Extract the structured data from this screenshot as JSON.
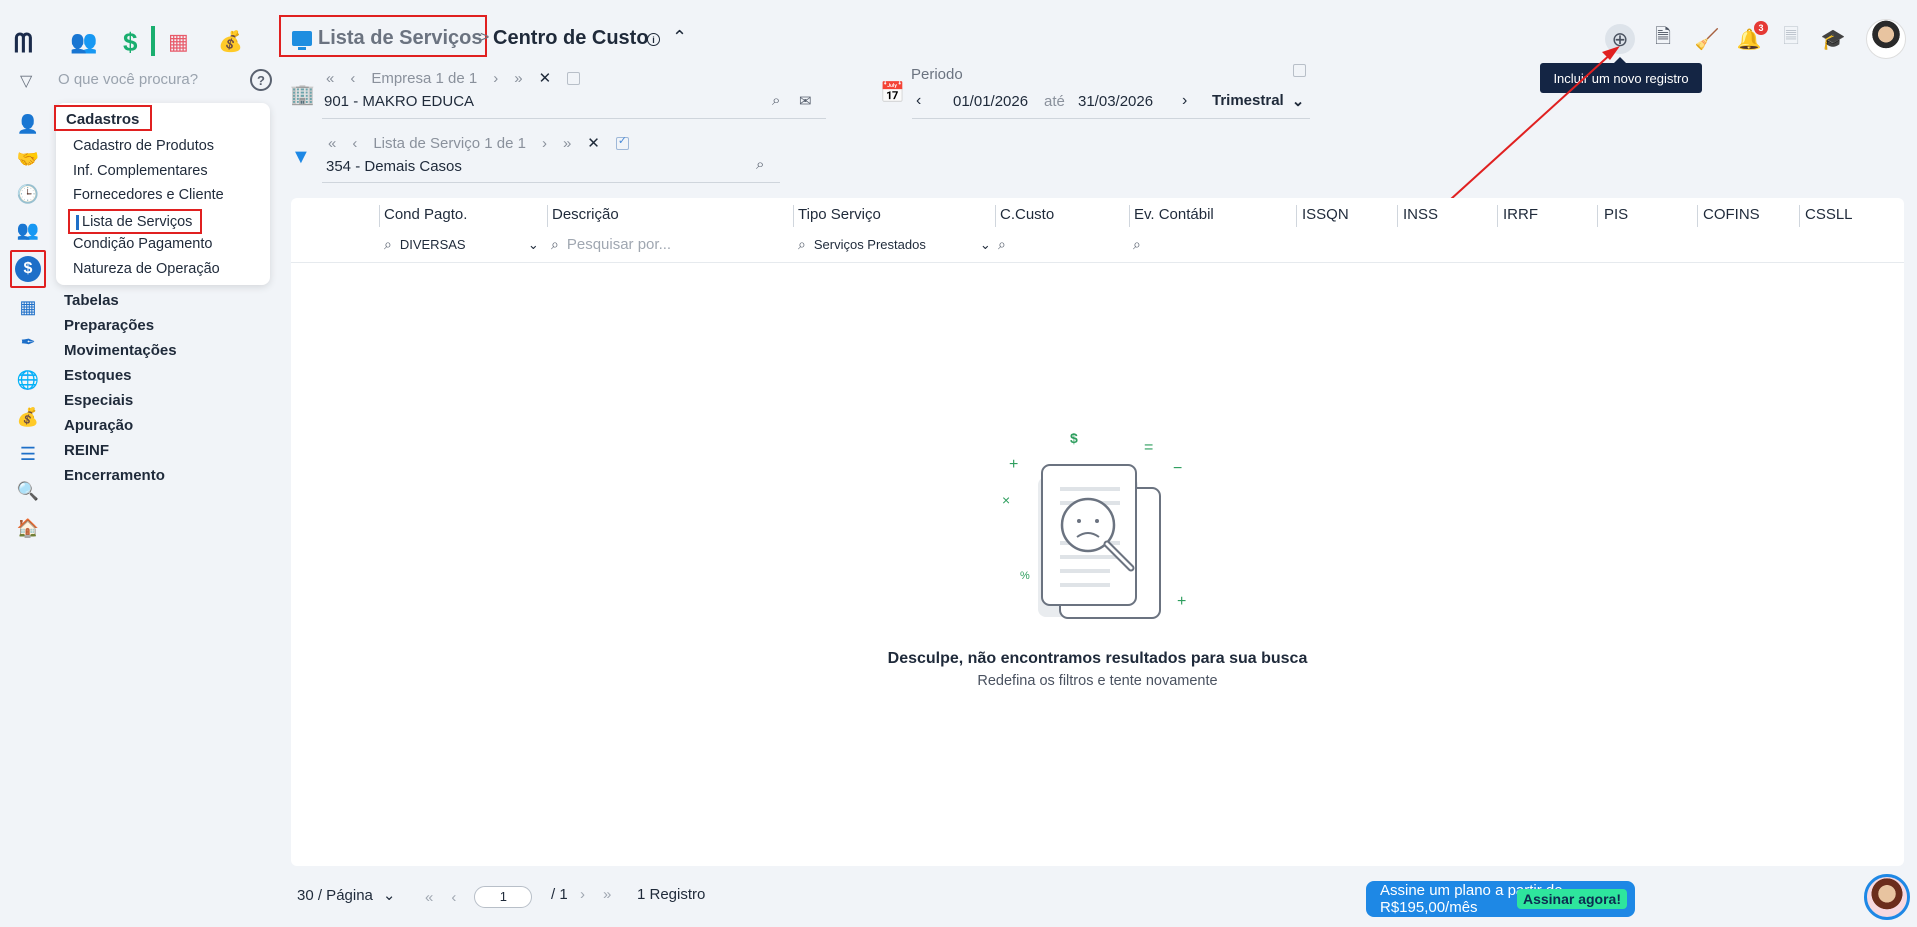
{
  "app": {
    "modules": [
      "people-icon",
      "dollar-icon",
      "divider",
      "calculator-icon",
      "money-bag-icon"
    ],
    "rail_icons": [
      "user-add-icon",
      "handshake-icon",
      "clock-icon",
      "users-icon",
      "dollar-coin-icon",
      "grid-icon",
      "pen-icon",
      "globe-icon",
      "money-bag-icon",
      "layers-icon",
      "search-icon",
      "home-icon"
    ]
  },
  "menu": {
    "search_placeholder": "O que você procura?",
    "help": "?",
    "section_title": "Cadastros",
    "sub_items": [
      "Cadastro de Produtos",
      "Inf. Complementares",
      "Fornecedores e Cliente",
      "Lista de Serviços",
      "Condição Pagamento",
      "Natureza de Operação"
    ],
    "groups": [
      "Tabelas",
      "Preparações",
      "Movimentações",
      "Estoques",
      "Especiais",
      "Apuração",
      "REINF",
      "Encerramento"
    ]
  },
  "header": {
    "breadcrumb1": "Lista de Serviços",
    "separator": ">",
    "breadcrumb2": "Centro de Custo",
    "info": "i",
    "collapse": "^",
    "tooltip": "Incluir um novo registro",
    "notification_count": "3"
  },
  "filters": {
    "empresa_pager": "Empresa 1 de 1",
    "empresa_value": "901 - MAKRO EDUCA",
    "periodo_label": "Periodo",
    "date_from": "01/01/2026",
    "ate": "até",
    "date_to": "31/03/2026",
    "period_type": "Trimestral",
    "servico_pager": "Lista de Serviço 1 de 1",
    "servico_value": "354 - Demais Casos"
  },
  "table": {
    "columns": [
      "Cond Pagto.",
      "Descrição",
      "Tipo Serviço",
      "C.Custo",
      "Ev. Contábil",
      "ISSQN",
      "INSS",
      "IRRF",
      "PIS",
      "COFINS",
      "CSSLL"
    ],
    "filter_cond": "DIVERSAS",
    "filter_desc_placeholder": "Pesquisar por...",
    "filter_tipo": "Serviços Prestados",
    "empty_title": "Desculpe, não encontramos resultados para sua busca",
    "empty_sub": "Redefina os filtros e tente novamente"
  },
  "footer": {
    "page_size": "30 / Página",
    "page_current": "1",
    "page_total": "/ 1",
    "records": "1 Registro",
    "promo_text": "Assine um plano a partir de R$195,00/mês",
    "promo_button": "Assinar agora!"
  }
}
